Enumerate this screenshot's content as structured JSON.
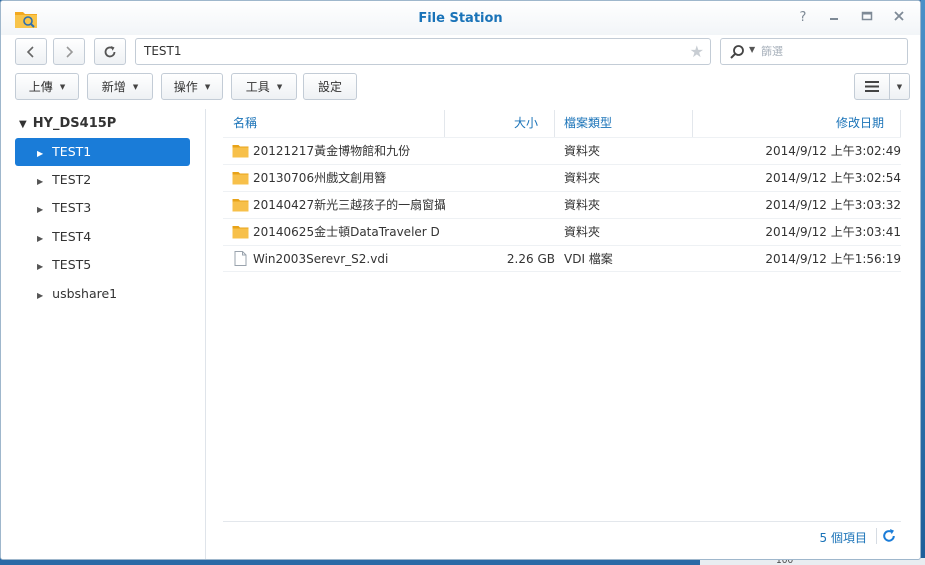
{
  "window": {
    "title": "File Station"
  },
  "toolbar": {
    "path": "TEST1",
    "search_placeholder": "篩選",
    "upload_label": "上傳",
    "create_label": "新增",
    "action_label": "操作",
    "tools_label": "工具",
    "settings_label": "設定"
  },
  "sidebar": {
    "root": "HY_DS415P",
    "items": [
      {
        "label": "TEST1",
        "selected": true
      },
      {
        "label": "TEST2"
      },
      {
        "label": "TEST3"
      },
      {
        "label": "TEST4"
      },
      {
        "label": "TEST5"
      },
      {
        "label": "usbshare1"
      }
    ]
  },
  "list": {
    "columns": {
      "name": "名稱",
      "size": "大小",
      "type": "檔案類型",
      "modified": "修改日期"
    },
    "rows": [
      {
        "icon": "folder-icon",
        "name": "20121217黃金博物館和九份",
        "size": "",
        "type": "資料夾",
        "modified": "2014/9/12 上午3:02:49"
      },
      {
        "icon": "folder-icon",
        "name": "20130706州戲文創用簪",
        "size": "",
        "type": "資料夾",
        "modified": "2014/9/12 上午3:02:54"
      },
      {
        "icon": "folder-icon",
        "name": "20140427新光三越孩子的一扇窗攝",
        "size": "",
        "type": "資料夾",
        "modified": "2014/9/12 上午3:03:32"
      },
      {
        "icon": "folder-icon",
        "name": "20140625金士頓DataTraveler D",
        "size": "",
        "type": "資料夾",
        "modified": "2014/9/12 上午3:03:41"
      },
      {
        "icon": "file-icon",
        "name": "Win2003Serevr_S2.vdi",
        "size": "2.26 GB",
        "type": "VDI 檔案",
        "modified": "2014/9/12 上午1:56:19"
      }
    ],
    "footer": {
      "count_text": "5 個項目"
    }
  },
  "desktop": {
    "partial_number": "100"
  },
  "colors": {
    "accent": "#1a7cd8",
    "link": "#1a73b8",
    "folder": "#f5b534"
  }
}
